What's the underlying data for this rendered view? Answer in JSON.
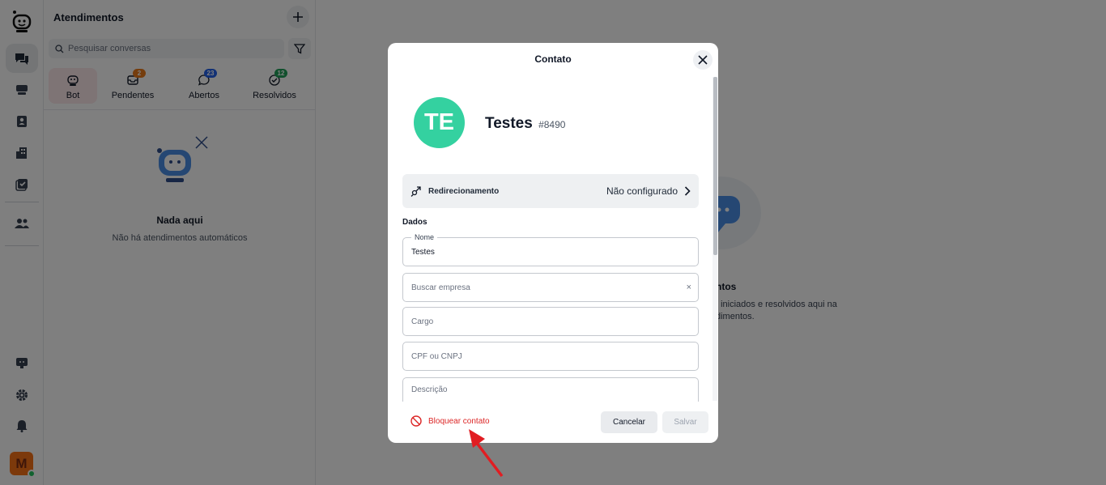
{
  "sidebar": {
    "icons": [
      "logo-icon",
      "chat-icon",
      "inbox-icon",
      "contacts-icon",
      "building-icon",
      "tasks-icon",
      "team-icon",
      "monitor-icon",
      "gear-icon",
      "bell-icon"
    ],
    "user_initial": "M"
  },
  "panel": {
    "title": "Atendimentos",
    "search_placeholder": "Pesquisar conversas",
    "tabs": [
      {
        "label": "Bot",
        "badge": ""
      },
      {
        "label": "Pendentes",
        "badge": "2",
        "badge_color": "#ea7a1a"
      },
      {
        "label": "Abertos",
        "badge": "23",
        "badge_color": "#2563eb"
      },
      {
        "label": "Resolvidos",
        "badge": "12",
        "badge_color": "#22a05a"
      }
    ],
    "empty_title": "Nada aqui",
    "empty_subtitle": "Não há atendimentos automáticos"
  },
  "background": {
    "title": "ntos",
    "subtitle_line1": ", iniciados e resolvidos aqui na",
    "subtitle_line2": "dimentos."
  },
  "modal": {
    "title": "Contato",
    "avatar_initials": "TE",
    "avatar_color": "#34d1a0",
    "contact_name": "Testes",
    "contact_id": "#8490",
    "redirect_label": "Redirecionamento",
    "redirect_value": "Não configurado",
    "section_label": "Dados",
    "fields": {
      "name_legend": "Nome",
      "name_value": "Testes",
      "company_placeholder": "Buscar empresa",
      "role_placeholder": "Cargo",
      "document_placeholder": "CPF ou CNPJ",
      "description_placeholder": "Descrição"
    },
    "block_label": "Bloquear contato",
    "cancel_label": "Cancelar",
    "save_label": "Salvar"
  },
  "colors": {
    "accent": "#dc2626",
    "overlay": "rgba(0,0,0,0.5)"
  }
}
